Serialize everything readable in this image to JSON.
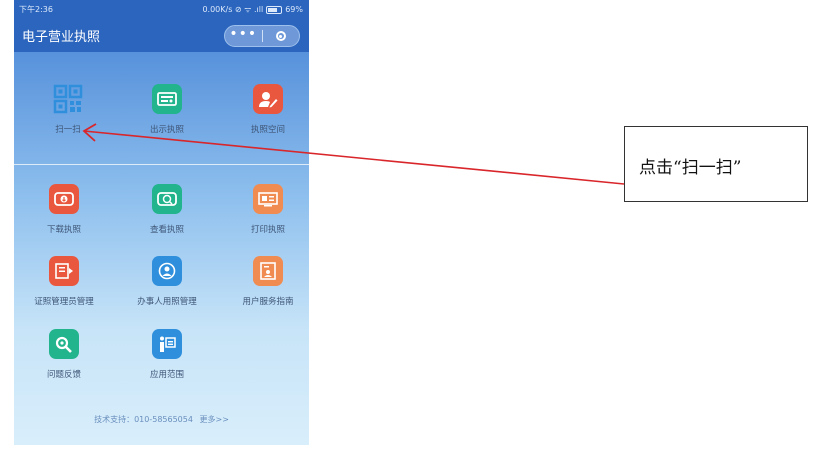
{
  "status_bar": {
    "time": "下午2:36",
    "info": "0.00K/s ⊘ ᯤ .ıll",
    "battery": "69%"
  },
  "header": {
    "title": "电子营业执照",
    "more_icon": "ellipsis-icon",
    "close_icon": "target-circle-icon"
  },
  "top_row": [
    {
      "label": "扫一扫",
      "icon": "qr-scan-icon",
      "color": "#2f8fdc"
    },
    {
      "label": "出示执照",
      "icon": "license-card-icon",
      "color": "#22b48c"
    },
    {
      "label": "执照空间",
      "icon": "user-edit-icon",
      "color": "#e9573f"
    }
  ],
  "grid": [
    {
      "label": "下载执照",
      "icon": "download-license-icon",
      "color": "#e9573f"
    },
    {
      "label": "查看执照",
      "icon": "view-license-icon",
      "color": "#22b48c"
    },
    {
      "label": "打印执照",
      "icon": "print-license-icon",
      "color": "#f08b51"
    },
    {
      "label": "证照管理员管理",
      "icon": "admin-manage-icon",
      "color": "#e9573f"
    },
    {
      "label": "办事人用照管理",
      "icon": "agent-manage-icon",
      "color": "#2f8fdc"
    },
    {
      "label": "用户服务指南",
      "icon": "service-guide-icon",
      "color": "#f08b51"
    },
    {
      "label": "问题反馈",
      "icon": "feedback-search-icon",
      "color": "#22b48c"
    },
    {
      "label": "应用范围",
      "icon": "application-scope-icon",
      "color": "#2f8fdc"
    }
  ],
  "footer": {
    "support": "技术支持：010-58565054",
    "more": "更多>>"
  },
  "annotation": {
    "callout_text": "点击“扫一扫”",
    "arrow_color": "#d9262b"
  }
}
